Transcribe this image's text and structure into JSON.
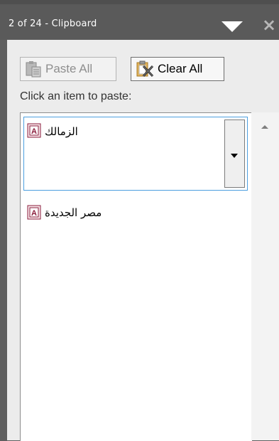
{
  "pane": {
    "title": "2 of 24 - Clipboard"
  },
  "toolbar": {
    "paste_all_label": "Paste All",
    "clear_all_label": "Clear All"
  },
  "instruction": "Click an item to paste:",
  "items": [
    {
      "text": "الزمالك",
      "icon": "access-document-icon",
      "selected": true
    },
    {
      "text": "مصر الجديدة",
      "icon": "access-document-icon",
      "selected": false
    }
  ],
  "colors": {
    "titlebar": "#5a5a5a",
    "panel": "#ececec",
    "selection_border": "#4c9fdf"
  }
}
